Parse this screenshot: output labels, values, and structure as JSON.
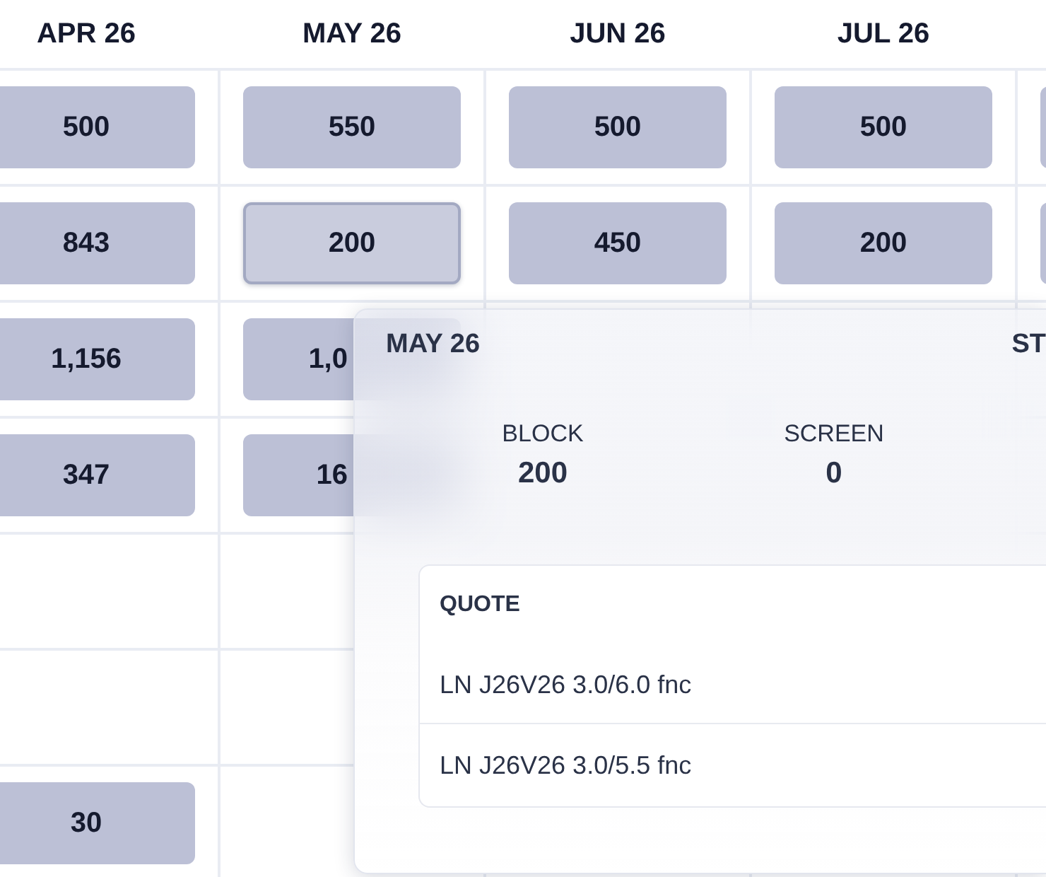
{
  "columns": [
    "APR 26",
    "MAY 26",
    "JUN 26",
    "JUL 26"
  ],
  "rows": [
    {
      "cells": [
        {
          "kind": "chip",
          "value": "500",
          "selected": false
        },
        {
          "kind": "chip",
          "value": "550",
          "selected": false
        },
        {
          "kind": "chip",
          "value": "500",
          "selected": false
        },
        {
          "kind": "chip",
          "value": "500",
          "selected": false
        },
        {
          "kind": "chip",
          "selected": false
        }
      ]
    },
    {
      "cells": [
        {
          "kind": "chip",
          "value": "843",
          "selected": false
        },
        {
          "kind": "chip",
          "value": "200",
          "selected": true
        },
        {
          "kind": "chip",
          "value": "450",
          "selected": false
        },
        {
          "kind": "chip",
          "value": "200",
          "selected": false
        },
        {
          "kind": "chip",
          "selected": false
        }
      ]
    },
    {
      "cells": [
        {
          "kind": "chip",
          "value": "1,156",
          "selected": false
        },
        {
          "kind": "chip_cut",
          "value": "1,0",
          "selected": false
        },
        {
          "kind": "empty"
        },
        {
          "kind": "empty"
        },
        {
          "kind": "empty"
        }
      ]
    },
    {
      "cells": [
        {
          "kind": "chip",
          "value": "347",
          "selected": false
        },
        {
          "kind": "chip_cut",
          "value": "16",
          "selected": false
        },
        {
          "kind": "covered"
        },
        {
          "kind": "covered"
        },
        {
          "kind": "empty"
        }
      ]
    },
    {
      "cells": [
        {
          "kind": "empty"
        },
        {
          "kind": "empty"
        },
        {
          "kind": "covered"
        },
        {
          "kind": "covered"
        },
        {
          "kind": "empty"
        }
      ]
    },
    {
      "cells": [
        {
          "kind": "empty"
        },
        {
          "kind": "empty"
        },
        {
          "kind": "empty"
        },
        {
          "kind": "empty"
        },
        {
          "kind": "empty"
        }
      ]
    },
    {
      "cells": [
        {
          "kind": "chip",
          "value": "30",
          "selected": false
        },
        {
          "kind": "empty"
        },
        {
          "kind": "empty"
        },
        {
          "kind": "empty"
        },
        {
          "kind": "empty"
        }
      ]
    }
  ],
  "popover": {
    "title": "MAY 26",
    "title_right": "ST",
    "stats": [
      {
        "label": "BLOCK",
        "value": "200"
      },
      {
        "label": "SCREEN",
        "value": "0"
      }
    ],
    "quote": {
      "heading": "QUOTE",
      "rows": [
        "LN J26V26 3.0/6.0 fnc",
        "LN J26V26 3.0/5.5 fnc"
      ]
    }
  }
}
